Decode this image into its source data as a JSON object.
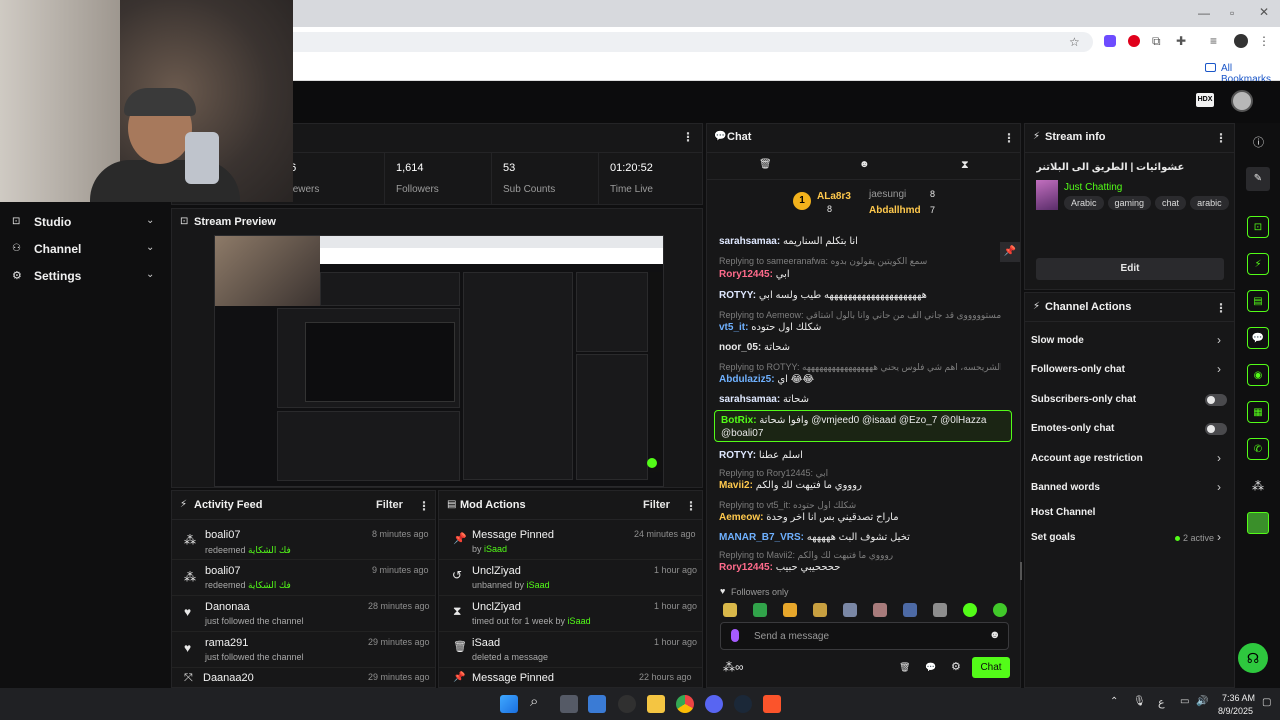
{
  "browser": {
    "bookmarks_label": "All Bookmarks"
  },
  "sidebar": {
    "items": [
      {
        "label": "Studio"
      },
      {
        "label": "Channel"
      },
      {
        "label": "Settings"
      }
    ]
  },
  "stats": {
    "items": [
      {
        "value": "56",
        "label": "Viewers"
      },
      {
        "value": "1,614",
        "label": "Followers"
      },
      {
        "value": "53",
        "label": "Sub Counts"
      },
      {
        "value": "01:20:52",
        "label": "Time Live"
      }
    ]
  },
  "stream_preview": {
    "title": "Stream Preview"
  },
  "activity_feed": {
    "title": "Activity Feed",
    "filter_label": "Filter",
    "items": [
      {
        "name": "boali07",
        "desc": "redeemed",
        "highlight": "فك الشكاية",
        "time": "8 minutes ago"
      },
      {
        "name": "boali07",
        "desc": "redeemed",
        "highlight": "فك الشكاية",
        "time": "9 minutes ago"
      },
      {
        "name": "Danonaa",
        "desc": "just followed the channel",
        "highlight": "",
        "time": "28 minutes ago"
      },
      {
        "name": "rama291",
        "desc": "just followed the channel",
        "highlight": "",
        "time": "29 minutes ago"
      },
      {
        "name": "Daanaa20",
        "desc": "",
        "highlight": "",
        "time": "29 minutes ago"
      }
    ]
  },
  "mod_actions": {
    "title": "Mod Actions",
    "filter_label": "Filter",
    "items": [
      {
        "name": "Message Pinned",
        "desc": "by",
        "by": "iSaad",
        "time": "24 minutes ago"
      },
      {
        "name": "UnclZiyad",
        "desc": "unbanned by",
        "by": "iSaad",
        "time": "1 hour ago"
      },
      {
        "name": "UnclZiyad",
        "desc": "timed out for 1 week by",
        "by": "iSaad",
        "time": "1 hour ago"
      },
      {
        "name": "iSaad",
        "desc": "deleted a message",
        "by": "",
        "time": "1 hour ago"
      },
      {
        "name": "Message Pinned",
        "desc": "",
        "by": "",
        "time": "22 hours ago"
      }
    ]
  },
  "chat": {
    "title": "Chat",
    "leaderboard": [
      {
        "rank": "1",
        "name": "ALa8r3",
        "count": "8"
      },
      {
        "rank": "",
        "name": "jaesungi",
        "count": "8"
      },
      {
        "rank": "",
        "name": "Abdallhmd",
        "count": "7"
      }
    ],
    "messages": [
      {
        "reply": "",
        "user": "sarahsamaa:",
        "text": "انا بتكلم السناريمه",
        "color": "#dfe8ff"
      },
      {
        "reply": "Replying to sameeranafwa: سمع الكويتين يقولون بدوه",
        "user": "Rory12445:",
        "text": "ابي",
        "color": "#ff6b8b"
      },
      {
        "reply": "",
        "user": "ROTYY:",
        "text": "هههههههههههههههههههههه طيب ولسه ابي",
        "color": "#dfe8ff"
      },
      {
        "reply": "Replying to Aemeow: مستوووووى قد جاني الف من حاني وانا بالول اشتاقي",
        "user": "vt5_it:",
        "text": "شكلك اول حتوده",
        "color": "#6fb1ff"
      },
      {
        "reply": "",
        "user": "noor_05:",
        "text": "شحاتة",
        "color": "#e9e9e9"
      },
      {
        "reply": "Replying to ROTYY: الشريحسه، اهم شي فلوس يحني هههههههههههههههههه",
        "user": "Abdulaziz5:",
        "text": "اي 😂😂",
        "color": "#6fb1ff"
      },
      {
        "reply": "",
        "user": "sarahsamaa:",
        "text": "شحاتة",
        "color": "#dfe8ff"
      },
      {
        "reply": "",
        "user": "BotRix:",
        "text": "وافوا شحاتة @vmjeed0 @isaad @Ezo_7 @0lHazza @boali07",
        "color": "#53fc18"
      },
      {
        "reply": "",
        "user": "ROTYY:",
        "text": "اسلم عطنا",
        "color": "#dfe8ff"
      },
      {
        "reply": "Replying to Rory12445: ابي",
        "user": "Mavii2:",
        "text": "روووي ما فتيهت لك والكم",
        "color": "#ffc94d"
      },
      {
        "reply": "Replying to vt5_it: شكلك اول حتوده",
        "user": "Aemeow:",
        "text": "ماراح تصدقيني بس انا اخر وحدة",
        "color": "#ffc94d"
      },
      {
        "reply": "",
        "user": "MANAR_B7_VRS:",
        "text": "تخيل تشوف البث هههههه",
        "color": "#6fb1ff"
      },
      {
        "reply": "Replying to Mavii2: روووي ما فتيهت لك والكم",
        "user": "Rory12445:",
        "text": "ححححيبي حبيب",
        "color": "#ff6b8b"
      }
    ],
    "followers_only": "Followers only",
    "input_placeholder": "Send a message",
    "send_label": "Chat"
  },
  "stream_info": {
    "title": "Stream info",
    "stream_title": "عشوائيات | الطريق الى البلاتنر",
    "category": "Just Chatting",
    "tags": [
      "Arabic",
      "gaming",
      "chat",
      "arabic"
    ],
    "edit_label": "Edit"
  },
  "channel_actions": {
    "title": "Channel Actions",
    "rows": [
      {
        "label": "Slow mode",
        "control": "chevron"
      },
      {
        "label": "Followers-only chat",
        "control": "chevron"
      },
      {
        "label": "Subscribers-only chat",
        "control": "toggle"
      },
      {
        "label": "Emotes-only chat",
        "control": "toggle"
      },
      {
        "label": "Account age restriction",
        "control": "chevron"
      },
      {
        "label": "Banned words",
        "control": "chevron"
      },
      {
        "label": "Host Channel",
        "control": "none"
      },
      {
        "label": "Set goals",
        "control": "chevron"
      }
    ],
    "goals_status": "2 active"
  },
  "taskbar": {
    "time": "7:36 AM",
    "date": "8/9/2025",
    "lang": "ع"
  },
  "colors": {
    "accent": "#53fc18",
    "panel": "#171718",
    "background": "#0f0f10"
  }
}
